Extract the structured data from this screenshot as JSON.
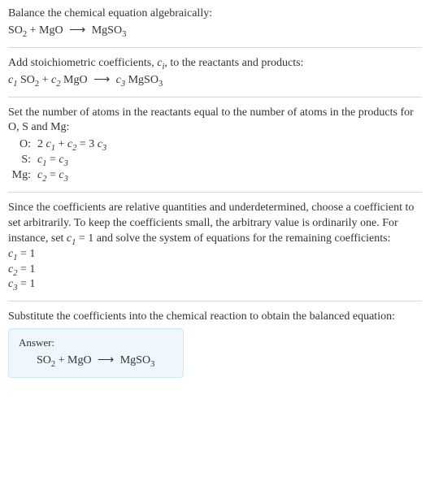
{
  "sec1": {
    "intro": "Balance the chemical equation algebraically:",
    "r1": "SO",
    "r1_sub": "2",
    "plus1": " + MgO ",
    "arrow": "⟶",
    "p1": " MgSO",
    "p1_sub": "3"
  },
  "sec2": {
    "intro1": "Add stoichiometric coefficients, ",
    "ci": "c",
    "ci_sub": "i",
    "intro2": ", to the reactants and products:",
    "c1": "c",
    "c1_sub": "1",
    "r1": " SO",
    "r1_sub": "2",
    "plus": " + ",
    "c2": "c",
    "c2_sub": "2",
    "r2": " MgO ",
    "arrow": "⟶",
    "sp": " ",
    "c3": "c",
    "c3_sub": "3",
    "p1": " MgSO",
    "p1_sub": "3"
  },
  "sec3": {
    "intro": "Set the number of atoms in the reactants equal to the number of atoms in the products for O, S and Mg:",
    "rows": {
      "o_lbl": "O:",
      "o_lhs1": "2 ",
      "o_c1": "c",
      "o_c1s": "1",
      "o_plus": " + ",
      "o_c2": "c",
      "o_c2s": "2",
      "o_eq": " = 3 ",
      "o_c3": "c",
      "o_c3s": "3",
      "s_lbl": "S:",
      "s_c1": "c",
      "s_c1s": "1",
      "s_eq": " = ",
      "s_c3": "c",
      "s_c3s": "3",
      "mg_lbl": "Mg:",
      "mg_c2": "c",
      "mg_c2s": "2",
      "mg_eq": " = ",
      "mg_c3": "c",
      "mg_c3s": "3"
    }
  },
  "sec4": {
    "intro1": "Since the coefficients are relative quantities and underdetermined, choose a coefficient to set arbitrarily. To keep the coefficients small, the arbitrary value is ordinarily one. For instance, set ",
    "cset": "c",
    "cset_sub": "1",
    "intro2": " = 1 and solve the system of equations for the remaining coefficients:",
    "l1a": "c",
    "l1s": "1",
    "l1b": " = 1",
    "l2a": "c",
    "l2s": "2",
    "l2b": " = 1",
    "l3a": "c",
    "l3s": "3",
    "l3b": " = 1"
  },
  "sec5": {
    "intro": "Substitute the coefficients into the chemical reaction to obtain the balanced equation:",
    "ans_label": "Answer:",
    "r1": "SO",
    "r1_sub": "2",
    "plus": " + MgO ",
    "arrow": "⟶",
    "p1": " MgSO",
    "p1_sub": "3"
  }
}
